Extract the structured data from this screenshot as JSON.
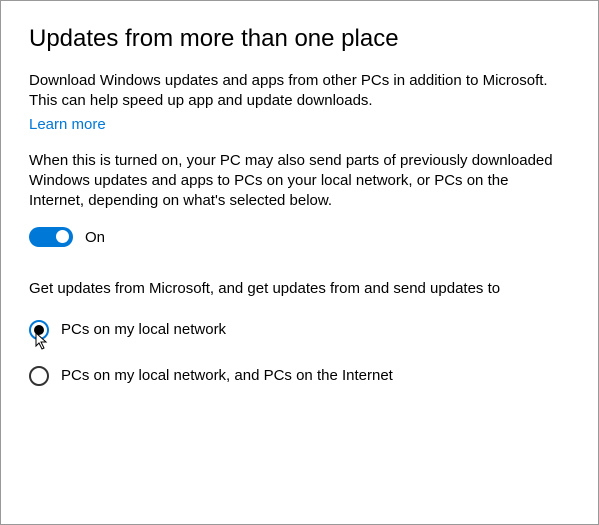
{
  "title": "Updates from more than one place",
  "intro": "Download Windows updates and apps from other PCs in addition to Microsoft. This can help speed up app and update downloads.",
  "learn_more": "Learn more",
  "detail": "When this is turned on, your PC may also send parts of previously downloaded Windows updates and apps to PCs on your local network, or PCs on the Internet, depending on what's selected below.",
  "toggle": {
    "state_label": "On"
  },
  "subheading": "Get updates from Microsoft, and get updates from and send updates to",
  "options": {
    "local": "PCs on my local network",
    "internet": "PCs on my local network, and PCs on the Internet"
  }
}
